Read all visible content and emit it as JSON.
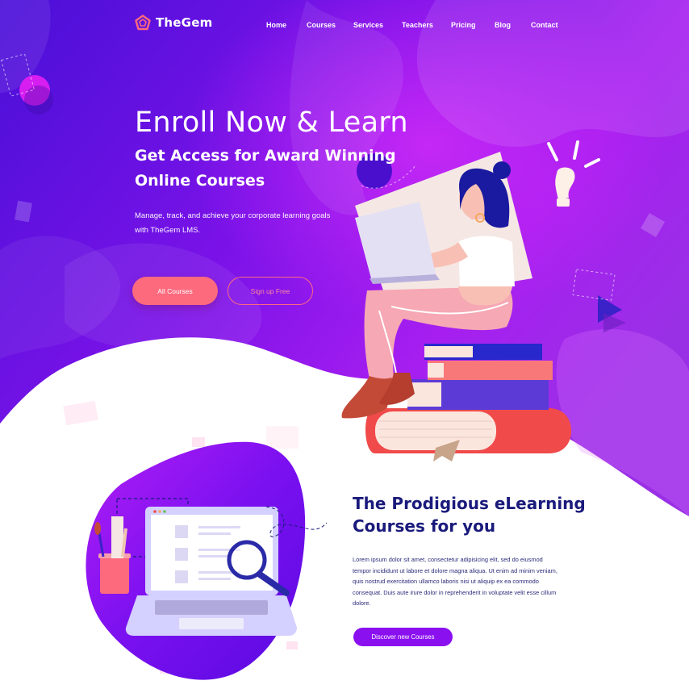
{
  "brand": {
    "name": "TheGem"
  },
  "nav": {
    "items": [
      {
        "label": "Home"
      },
      {
        "label": "Courses"
      },
      {
        "label": "Services"
      },
      {
        "label": "Teachers"
      },
      {
        "label": "Pricing"
      },
      {
        "label": "Blog"
      },
      {
        "label": "Contact"
      }
    ]
  },
  "hero": {
    "title": "Enroll Now & Learn",
    "subtitle": "Get Access for Award Winning Online Courses",
    "description": "Manage, track, and achieve your corporate learning goals with TheGem LMS.",
    "primary_button": "All Courses",
    "secondary_button": "Sign up Free"
  },
  "section": {
    "title": "The Prodigious eLearning Courses for you",
    "body": "Lorem ipsum dolor sit amet, consectetur adipisicing elit, sed do eiusmod tempor incididunt ut labore et dolore magna aliqua. Ut enim ad minim veniam, quis nostrud exercitation ullamco laboris nisi ut aliquip ex ea commodo consequat. Duis aute irure dolor in reprehenderit in voluptate velit esse cillum dolore.",
    "button": "Discover new Courses"
  },
  "colors": {
    "hero_purple": "#6a0fe0",
    "magenta": "#b41cf0",
    "coral": "#fd6a7e",
    "navy": "#1a1a7c",
    "button_purple": "#8a10f0"
  },
  "icons": [
    "pentagon-logo-icon",
    "lightbulb-icon",
    "play-triangle-icon",
    "magnifier-icon"
  ]
}
